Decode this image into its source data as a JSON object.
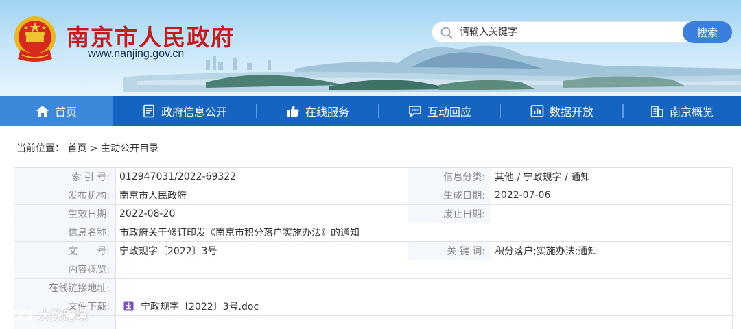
{
  "header": {
    "site_title": "南京市人民政府",
    "site_url": "www.nanjing.gov.cn",
    "emblem_icon": "national-emblem-icon"
  },
  "search": {
    "placeholder": "请输入关键字",
    "button_label": "搜索"
  },
  "nav": {
    "items": [
      {
        "label": "首页",
        "icon": "home-icon",
        "active": true
      },
      {
        "label": "政府信息公开",
        "icon": "document-icon",
        "active": false
      },
      {
        "label": "在线服务",
        "icon": "thumbs-up-icon",
        "active": false
      },
      {
        "label": "互动回应",
        "icon": "chat-icon",
        "active": false
      },
      {
        "label": "数据开放",
        "icon": "bar-chart-icon",
        "active": false
      },
      {
        "label": "南京概览",
        "icon": "building-icon",
        "active": false
      }
    ]
  },
  "breadcrumb": {
    "prefix": "当前位置：",
    "home": "首页",
    "separator": ">",
    "current": "主动公开目录"
  },
  "info": {
    "index_no_label": "索 引 号:",
    "index_no": "012947031/2022-69322",
    "category_label": "信息分类:",
    "category": "其他 / 宁政规字 / 通知",
    "publisher_label": "发布机构:",
    "publisher": "南京市人民政府",
    "created_label": "生成日期:",
    "created": "2022-07-06",
    "effective_label": "生效日期:",
    "effective": "2022-08-20",
    "expiry_label": "废止日期:",
    "expiry": "",
    "title_label": "信息名称:",
    "title": "市政府关于修订印发《南京市积分落户实施办法》的通知",
    "doc_no_label": "文　　号:",
    "doc_no": "宁政规字〔2022〕3号",
    "keywords_label": "关 键 词:",
    "keywords": "积分落户;实施办法;通知",
    "summary_label": "内容概览:",
    "summary": "",
    "link_label": "在线链接地址:",
    "link": "",
    "download_label": "文件下载:",
    "download_file": "宁政规字〔2022〕3号.doc"
  },
  "watermark": {
    "text": "大数跨境"
  },
  "colors": {
    "nav_bg": "#1565c0",
    "nav_active": "#3c88da",
    "search_button": "#3a7fdd",
    "title_red": "#c81a1a",
    "label_bg": "#f4f8fc"
  }
}
